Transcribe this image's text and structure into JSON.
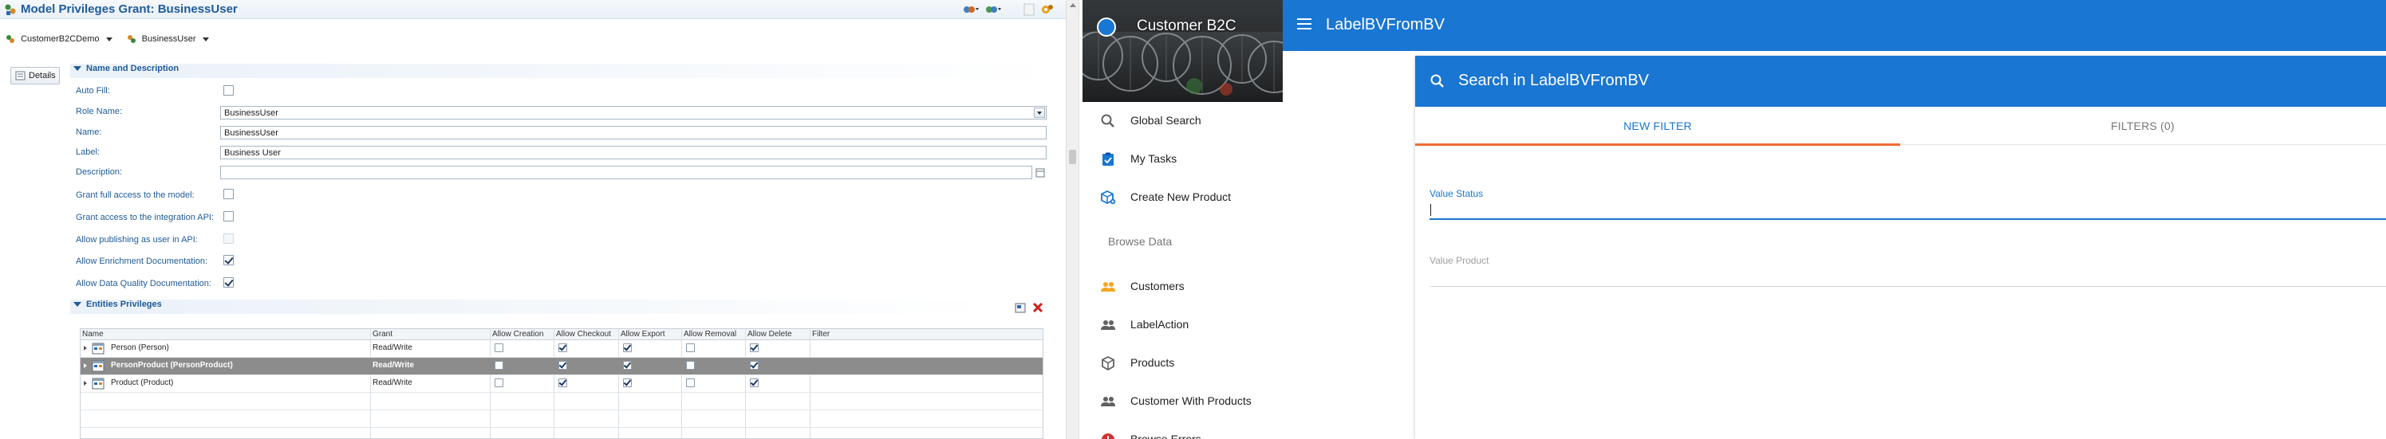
{
  "left": {
    "title": "Model Privileges Grant: BusinessUser",
    "context": {
      "model": "CustomerB2CDemo",
      "role": "BusinessUser"
    },
    "details_button": "Details",
    "section_name": "Name and Description",
    "fields": {
      "auto_fill": "Auto Fill:",
      "role_name": "Role Name:",
      "role_name_value": "BusinessUser",
      "name": "Name:",
      "name_value": "BusinessUser",
      "label": "Label:",
      "label_value": "Business User",
      "description": "Description:",
      "description_value": "",
      "grant_full_access": "Grant full access to the model:",
      "grant_integration": "Grant access to the integration API:",
      "allow_publishing": "Allow publishing as user in API:",
      "allow_enrichment": "Allow Enrichment Documentation:",
      "allow_dq": "Allow Data Quality Documentation:"
    },
    "checks": {
      "auto_fill": false,
      "grant_full_access": false,
      "grant_integration": false,
      "allow_publishing": false,
      "allow_enrichment": true,
      "allow_dq": true
    },
    "section_entities": "Entities Privileges",
    "grid": {
      "columns": [
        "Name",
        "Grant",
        "Allow Creation",
        "Allow Checkout",
        "Allow Export",
        "Allow Removal",
        "Allow Delete",
        "Filter"
      ],
      "rows": [
        {
          "name": "Person (Person)",
          "grant": "Read/Write",
          "creation": false,
          "checkout": true,
          "export": true,
          "removal": false,
          "delete": true,
          "selected": false
        },
        {
          "name": "PersonProduct (PersonProduct)",
          "grant": "Read/Write",
          "creation": false,
          "checkout": true,
          "export": true,
          "removal": false,
          "delete": true,
          "selected": true
        },
        {
          "name": "Product (Product)",
          "grant": "Read/Write",
          "creation": false,
          "checkout": true,
          "export": true,
          "removal": false,
          "delete": true,
          "selected": false
        }
      ]
    }
  },
  "mid": {
    "brand": "Customer B2C",
    "items": [
      {
        "label": "Global Search",
        "icon": "search-icon"
      },
      {
        "label": "My Tasks",
        "icon": "tasks-icon"
      },
      {
        "label": "Create New Product",
        "icon": "create-product-icon"
      }
    ],
    "browse_heading": "Browse Data",
    "browse_items": [
      {
        "label": "Customers",
        "icon": "customers-icon",
        "color": "#f5a623"
      },
      {
        "label": "LabelAction",
        "icon": "people-icon",
        "color": "#616161"
      },
      {
        "label": "Products",
        "icon": "box-icon",
        "color": "#616161"
      },
      {
        "label": "Customer With Products",
        "icon": "people-icon",
        "color": "#616161"
      },
      {
        "label": "Browse Errors",
        "icon": "error-icon",
        "color": "#d32f2f"
      }
    ]
  },
  "right": {
    "app_title": "LabelBVFromBV",
    "search_title": "Search in LabelBVFromBV",
    "tabs": [
      {
        "label": "NEW FILTER",
        "active": true
      },
      {
        "label": "FILTERS (0)",
        "active": false
      }
    ],
    "fields": [
      {
        "label": "Value Status",
        "focused": true
      },
      {
        "label": "Value Product",
        "focused": false
      }
    ],
    "colors": {
      "primary": "#1976d2",
      "tab_indicator": "#ef6c35"
    }
  }
}
